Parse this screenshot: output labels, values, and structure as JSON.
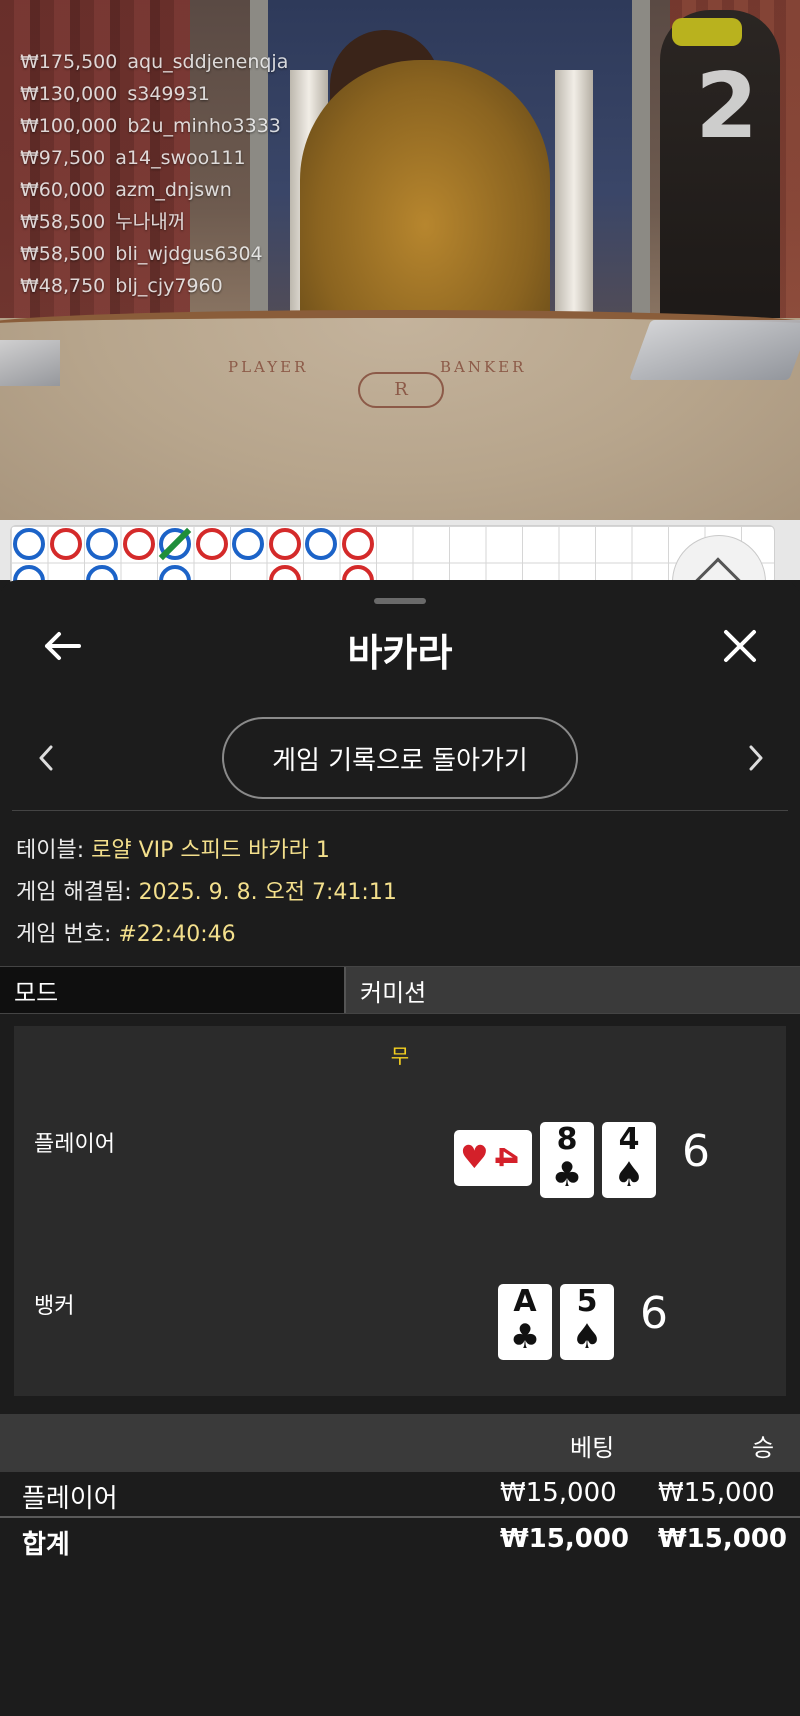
{
  "stream": {
    "leaderboard": [
      {
        "amount": "₩175,500",
        "user": "aqu_sddjenenqja"
      },
      {
        "amount": "₩130,000",
        "user": "s349931"
      },
      {
        "amount": "₩100,000",
        "user": "b2u_minho3333"
      },
      {
        "amount": "₩97,500",
        "user": "a14_swoo111"
      },
      {
        "amount": "₩60,000",
        "user": "azm_dnjswn"
      },
      {
        "amount": "₩58,500",
        "user": "누나내꺼"
      },
      {
        "amount": "₩58,500",
        "user": "bli_wjdgus6304"
      },
      {
        "amount": "₩48,750",
        "user": "blj_cjy7960"
      }
    ],
    "round_number": "2",
    "felt_player": "PLAYER",
    "felt_banker": "BANKER",
    "felt_logo": "R"
  },
  "road": {
    "row1": [
      "B",
      "R",
      "B",
      "R",
      "B",
      "R",
      "B",
      "R",
      "B",
      "R"
    ],
    "row2": [
      "B",
      "",
      "B",
      "",
      "B",
      "",
      "",
      "R",
      "",
      "R"
    ],
    "tie_mark_col": 4,
    "colors": {
      "banker_red": "#d42a2a",
      "player_blue": "#1c63c8",
      "tie_green": "#1f8f3b"
    }
  },
  "header": {
    "title": "바카라",
    "back_icon": "arrow-left-icon",
    "close_icon": "close-icon"
  },
  "nav": {
    "back_to_history": "게임 기록으로 돌아가기"
  },
  "info": {
    "table_label": "테이블: ",
    "table_value": "로얄 VIP 스피드 바카라 1",
    "resolved_label": "게임 해결됨: ",
    "resolved_value": "2025. 9. 8. 오전 7:41:11",
    "number_label": "게임 번호: ",
    "number_value": "#22:40:46"
  },
  "tabs": {
    "mode": "모드",
    "commission": "커미션"
  },
  "result": {
    "outcome": "무",
    "player": {
      "label": "플레이어",
      "score": "6",
      "cards": [
        {
          "rank": "4",
          "suit": "♥",
          "orientation": "sideways"
        },
        {
          "rank": "8",
          "suit": "♣"
        },
        {
          "rank": "4",
          "suit": "♠"
        }
      ]
    },
    "banker": {
      "label": "뱅커",
      "score": "6",
      "cards": [
        {
          "rank": "A",
          "suit": "♣"
        },
        {
          "rank": "5",
          "suit": "♠"
        }
      ]
    }
  },
  "bets_table": {
    "col_bet": "베팅",
    "col_win": "승",
    "rows": [
      {
        "name": "플레이어",
        "bet": "₩15,000",
        "win": "₩15,000"
      }
    ],
    "total": {
      "name": "합계",
      "bet": "₩15,000",
      "win": "₩15,000"
    }
  }
}
